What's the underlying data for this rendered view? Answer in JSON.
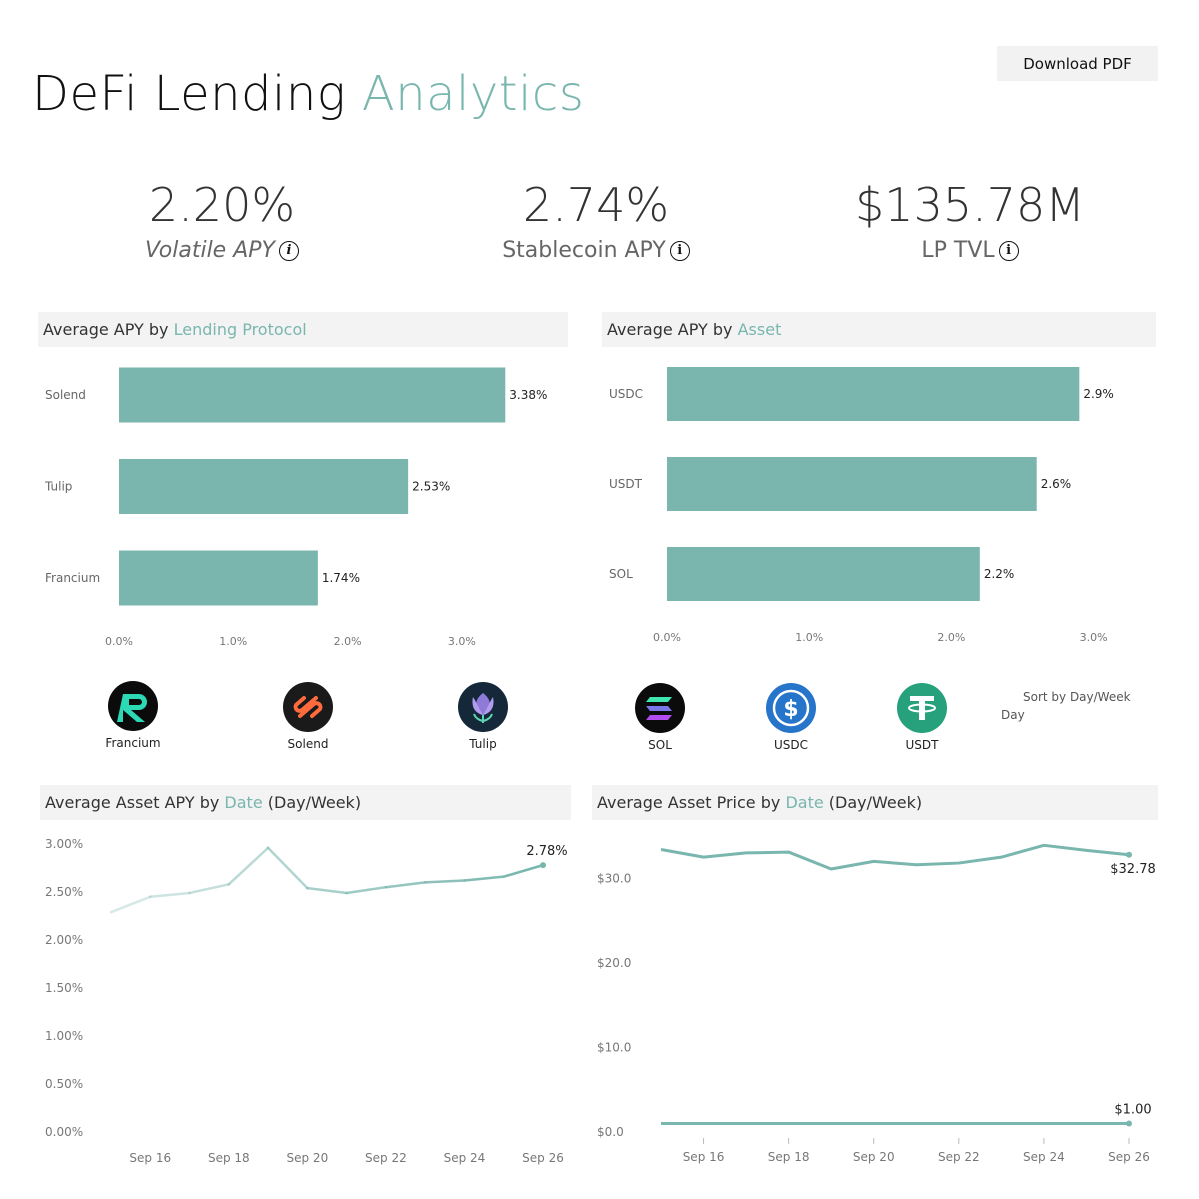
{
  "title": {
    "main": "DeFi Lending",
    "accent": "Analytics"
  },
  "download_label": "Download PDF",
  "kpis": [
    {
      "value": "2.20%",
      "label": "Volatile APY"
    },
    {
      "value": "2.74%",
      "label": "Stablecoin APY"
    },
    {
      "value": "$135.78M",
      "label": "LP TVL"
    }
  ],
  "info_glyph": "i",
  "panels": {
    "protocol": {
      "prefix": "Average APY by ",
      "accent": "Lending Protocol"
    },
    "asset": {
      "prefix": "Average APY by ",
      "accent": "Asset"
    },
    "asset_apy_date": {
      "prefix": "Average Asset APY by ",
      "accent": "Date",
      "suffix": " (Day/Week)"
    },
    "asset_price_date": {
      "prefix": "Average Asset Price by ",
      "accent": "Date",
      "suffix": " (Day/Week)"
    }
  },
  "protocol_logos": [
    {
      "label": "Francium",
      "icon": "francium-logo"
    },
    {
      "label": "Solend",
      "icon": "solend-logo"
    },
    {
      "label": "Tulip",
      "icon": "tulip-logo"
    }
  ],
  "asset_logos": [
    {
      "label": "SOL",
      "icon": "sol-logo"
    },
    {
      "label": "USDC",
      "icon": "usdc-logo"
    },
    {
      "label": "USDT",
      "icon": "usdt-logo"
    }
  ],
  "sort": {
    "label": "Sort by Day/Week",
    "value": "Day"
  },
  "colors": {
    "accent": "#79b6ae",
    "bar": "#7ab6ae"
  },
  "chart_data": [
    {
      "type": "bar",
      "orientation": "horizontal",
      "categories": [
        "Solend",
        "Tulip",
        "Francium"
      ],
      "values": [
        3.38,
        2.53,
        1.74
      ],
      "value_labels": [
        "3.38%",
        "2.53%",
        "1.74%"
      ],
      "xlim": [
        0,
        3.5
      ],
      "xticks": [
        0,
        1,
        2,
        3
      ],
      "xtick_labels": [
        "0.0%",
        "1.0%",
        "2.0%",
        "3.0%"
      ]
    },
    {
      "type": "bar",
      "orientation": "horizontal",
      "categories": [
        "USDC",
        "USDT",
        "SOL"
      ],
      "values": [
        2.9,
        2.6,
        2.2
      ],
      "value_labels": [
        "2.9%",
        "2.6%",
        "2.2%"
      ],
      "xlim": [
        0,
        3.2
      ],
      "xticks": [
        0,
        1,
        2,
        3
      ],
      "xtick_labels": [
        "0.0%",
        "1.0%",
        "2.0%",
        "3.0%"
      ]
    },
    {
      "type": "line",
      "x": [
        "Sep 15",
        "Sep 16",
        "Sep 17",
        "Sep 18",
        "Sep 19",
        "Sep 20",
        "Sep 21",
        "Sep 22",
        "Sep 23",
        "Sep 24",
        "Sep 25",
        "Sep 26"
      ],
      "series": [
        {
          "values": [
            2.29,
            2.45,
            2.49,
            2.58,
            2.96,
            2.54,
            2.49,
            2.55,
            2.6,
            2.62,
            2.66,
            2.78
          ]
        }
      ],
      "end_label": "2.78%",
      "ylim": [
        0,
        3.0
      ],
      "yticks": [
        0,
        0.5,
        1.0,
        1.5,
        2.0,
        2.5,
        3.0
      ],
      "ytick_labels": [
        "0.00%",
        "0.50%",
        "1.00%",
        "1.50%",
        "2.00%",
        "2.50%",
        "3.00%"
      ],
      "xtick_labels": [
        "Sep 16",
        "Sep 18",
        "Sep 20",
        "Sep 22",
        "Sep 24",
        "Sep 26"
      ]
    },
    {
      "type": "line",
      "x": [
        "Sep 15",
        "Sep 16",
        "Sep 17",
        "Sep 18",
        "Sep 19",
        "Sep 20",
        "Sep 21",
        "Sep 22",
        "Sep 23",
        "Sep 24",
        "Sep 25",
        "Sep 26"
      ],
      "series": [
        {
          "values": [
            33.4,
            32.5,
            33.0,
            33.1,
            31.1,
            32.0,
            31.6,
            31.8,
            32.5,
            33.9,
            33.3,
            32.78
          ],
          "end_label": "$32.78"
        },
        {
          "values": [
            1.0,
            1.0,
            1.0,
            1.0,
            1.0,
            1.0,
            1.0,
            1.0,
            1.0,
            1.0,
            1.0,
            1.0
          ],
          "end_label": "$1.00"
        }
      ],
      "ylim": [
        0,
        35
      ],
      "yticks": [
        0,
        10,
        20,
        30
      ],
      "ytick_labels": [
        "$0.0",
        "$10.0",
        "$20.0",
        "$30.0"
      ],
      "xtick_labels": [
        "Sep 16",
        "Sep 18",
        "Sep 20",
        "Sep 22",
        "Sep 24",
        "Sep 26"
      ]
    }
  ]
}
